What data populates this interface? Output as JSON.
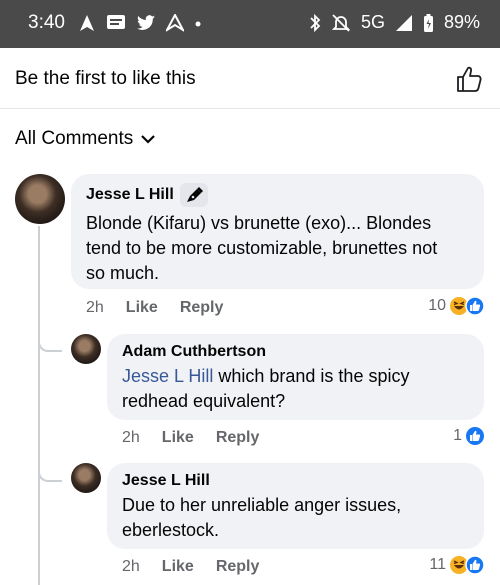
{
  "status": {
    "time": "3:40",
    "network": "5G",
    "battery": "89%"
  },
  "likes_bar": {
    "text": "Be the first to like this"
  },
  "comments_header": {
    "label": "All Comments"
  },
  "comments": [
    {
      "author": "Jesse L Hill",
      "text_lines": [
        "Blonde (Kifaru) vs brunette (exo)... Blondes",
        "tend to be more customizable, brunettes not",
        "so much."
      ],
      "time": "2h",
      "like": "Like",
      "reply": "Reply",
      "reactions": "10"
    },
    {
      "author": "Adam Cuthbertson",
      "mention": "Jesse L Hill",
      "text_line1_rest": " which brand is the spicy",
      "text_line2": "redhead equivalent?",
      "time": "2h",
      "like": "Like",
      "reply": "Reply",
      "reactions": "1"
    },
    {
      "author": "Jesse L Hill",
      "text_lines": [
        "Due to her unreliable anger issues,",
        "eberlestock."
      ],
      "time": "2h",
      "like": "Like",
      "reply": "Reply",
      "reactions": "11"
    }
  ],
  "colors": {
    "like_blue": "#1877f2",
    "haha_yellow": "#f7b125",
    "bubble_bg": "#f0f2f5",
    "mention": "#385898"
  }
}
